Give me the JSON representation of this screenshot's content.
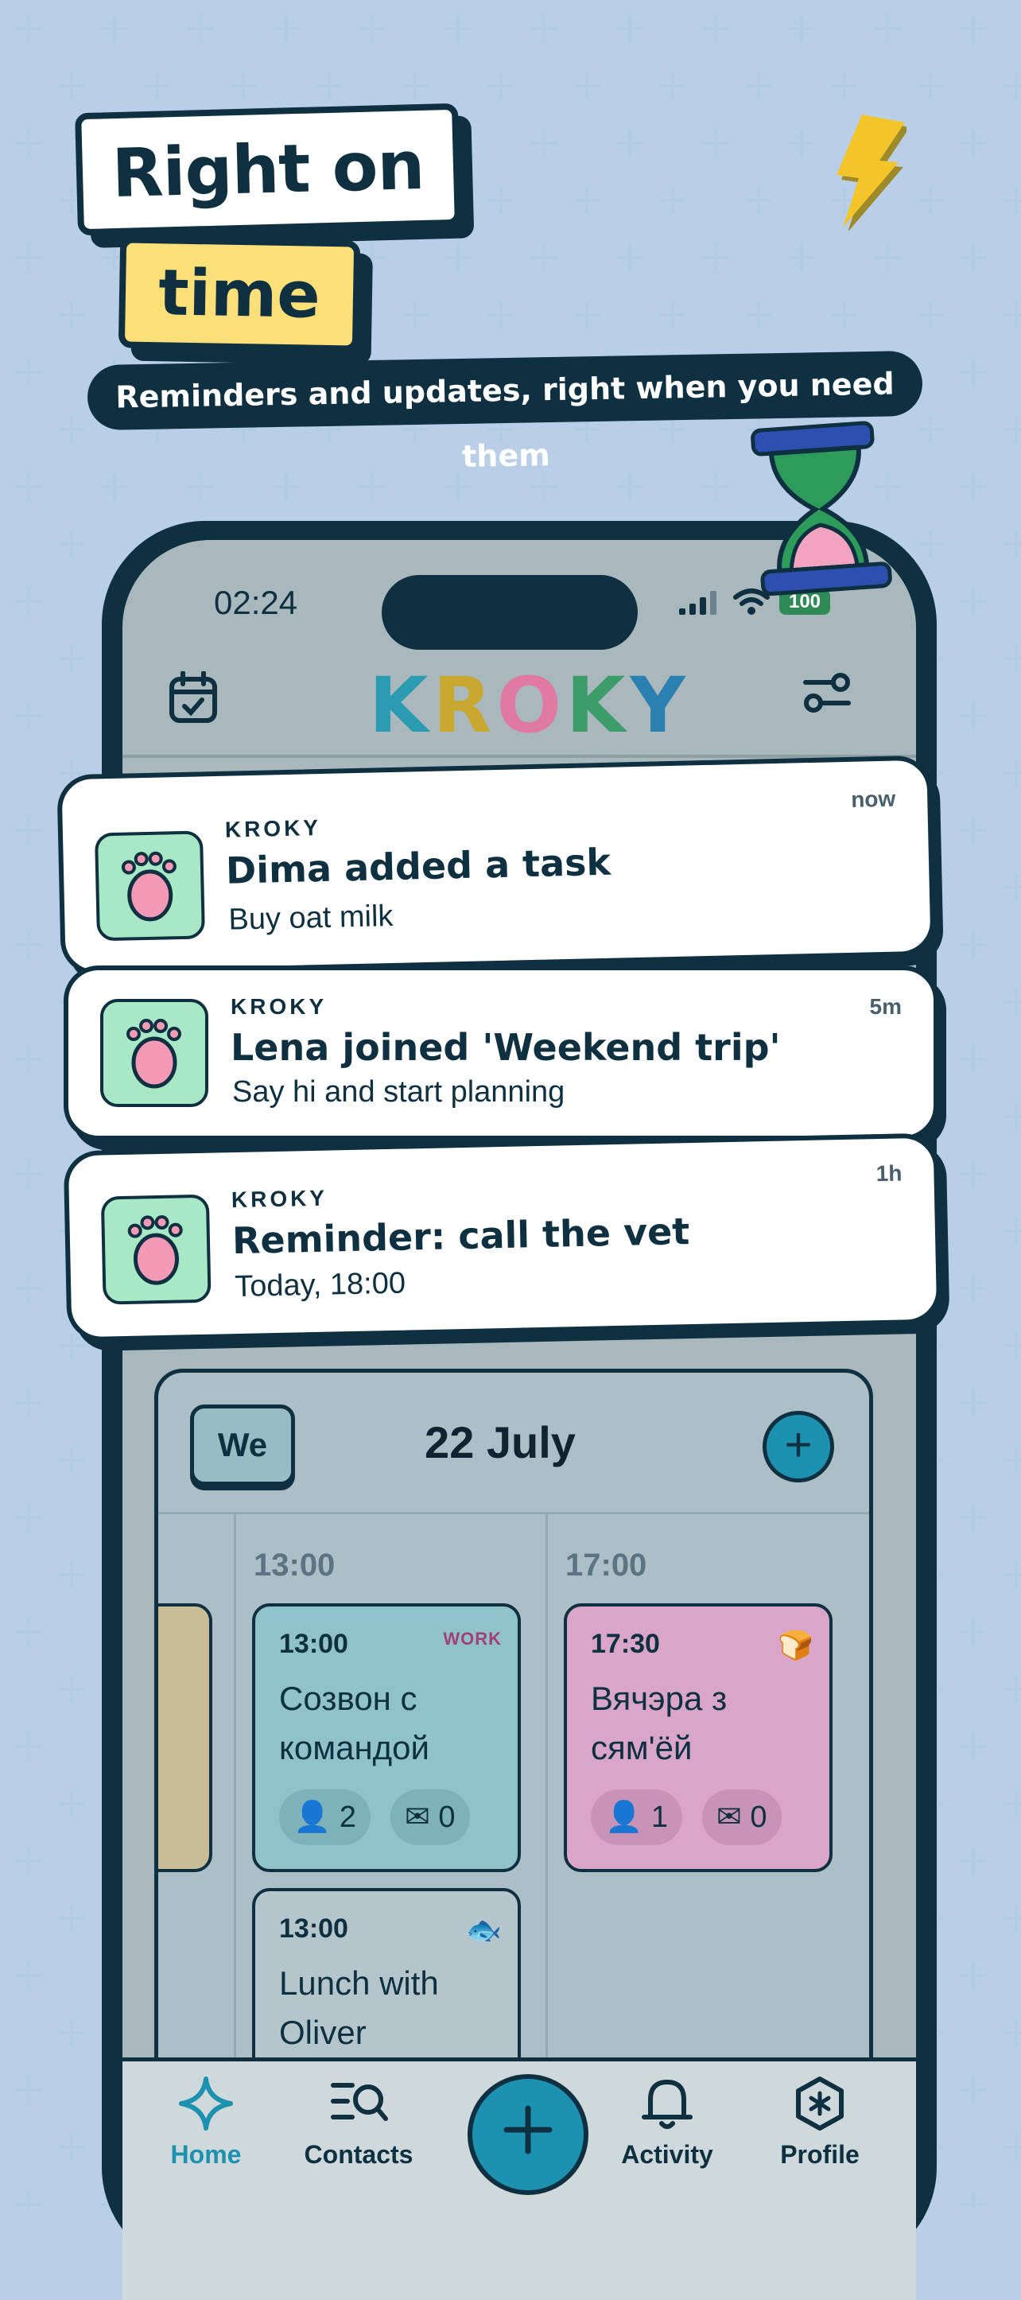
{
  "headline": {
    "line1": "Right on",
    "line2": "time",
    "subtitle": "Reminders and updates, right when you need them"
  },
  "status_bar": {
    "time": "02:24",
    "battery": "100"
  },
  "app": {
    "logo": "KROKY"
  },
  "notifications": [
    {
      "app": "KROKY",
      "title": "Dima added a task",
      "body": "Buy oat milk",
      "time": "now"
    },
    {
      "app": "KROKY",
      "title": "Lena joined 'Weekend trip'",
      "body": "Say hi and start planning",
      "time": "5m"
    },
    {
      "app": "KROKY",
      "title": "Reminder: call the vet",
      "body": "Today, 18:00",
      "time": "1h"
    }
  ],
  "day_view": {
    "weekday": "We",
    "date": "22 July",
    "columns": [
      "13:00",
      "17:00"
    ],
    "events": [
      {
        "time": "13:00",
        "title": "Созвон с командой",
        "people": "2",
        "messages": "0",
        "tag": "WORK",
        "color": "#8fc3c9"
      },
      {
        "time": "17:30",
        "title": "Вячэра з сям'ёй",
        "people": "1",
        "messages": "0",
        "tag": "bread",
        "color": "#d9a5c9"
      },
      {
        "time": "13:00",
        "title": "Lunch with Oliver",
        "tag": "fish",
        "color": "#b4c6cc"
      }
    ]
  },
  "tabs": [
    {
      "label": "Home",
      "icon": "sparkle-icon",
      "active": true
    },
    {
      "label": "Contacts",
      "icon": "contacts-search-icon"
    },
    {
      "label": "",
      "icon": "plus-icon"
    },
    {
      "label": "Activity",
      "icon": "bell-icon"
    },
    {
      "label": "Profile",
      "icon": "asterisk-badge-icon"
    }
  ],
  "colors": {
    "background": "#cfe1f6",
    "dark": "#0f3040",
    "accent": "#1d91b0",
    "highlight": "#fbe07a",
    "app_icon_bg": "#a9e8c6"
  }
}
